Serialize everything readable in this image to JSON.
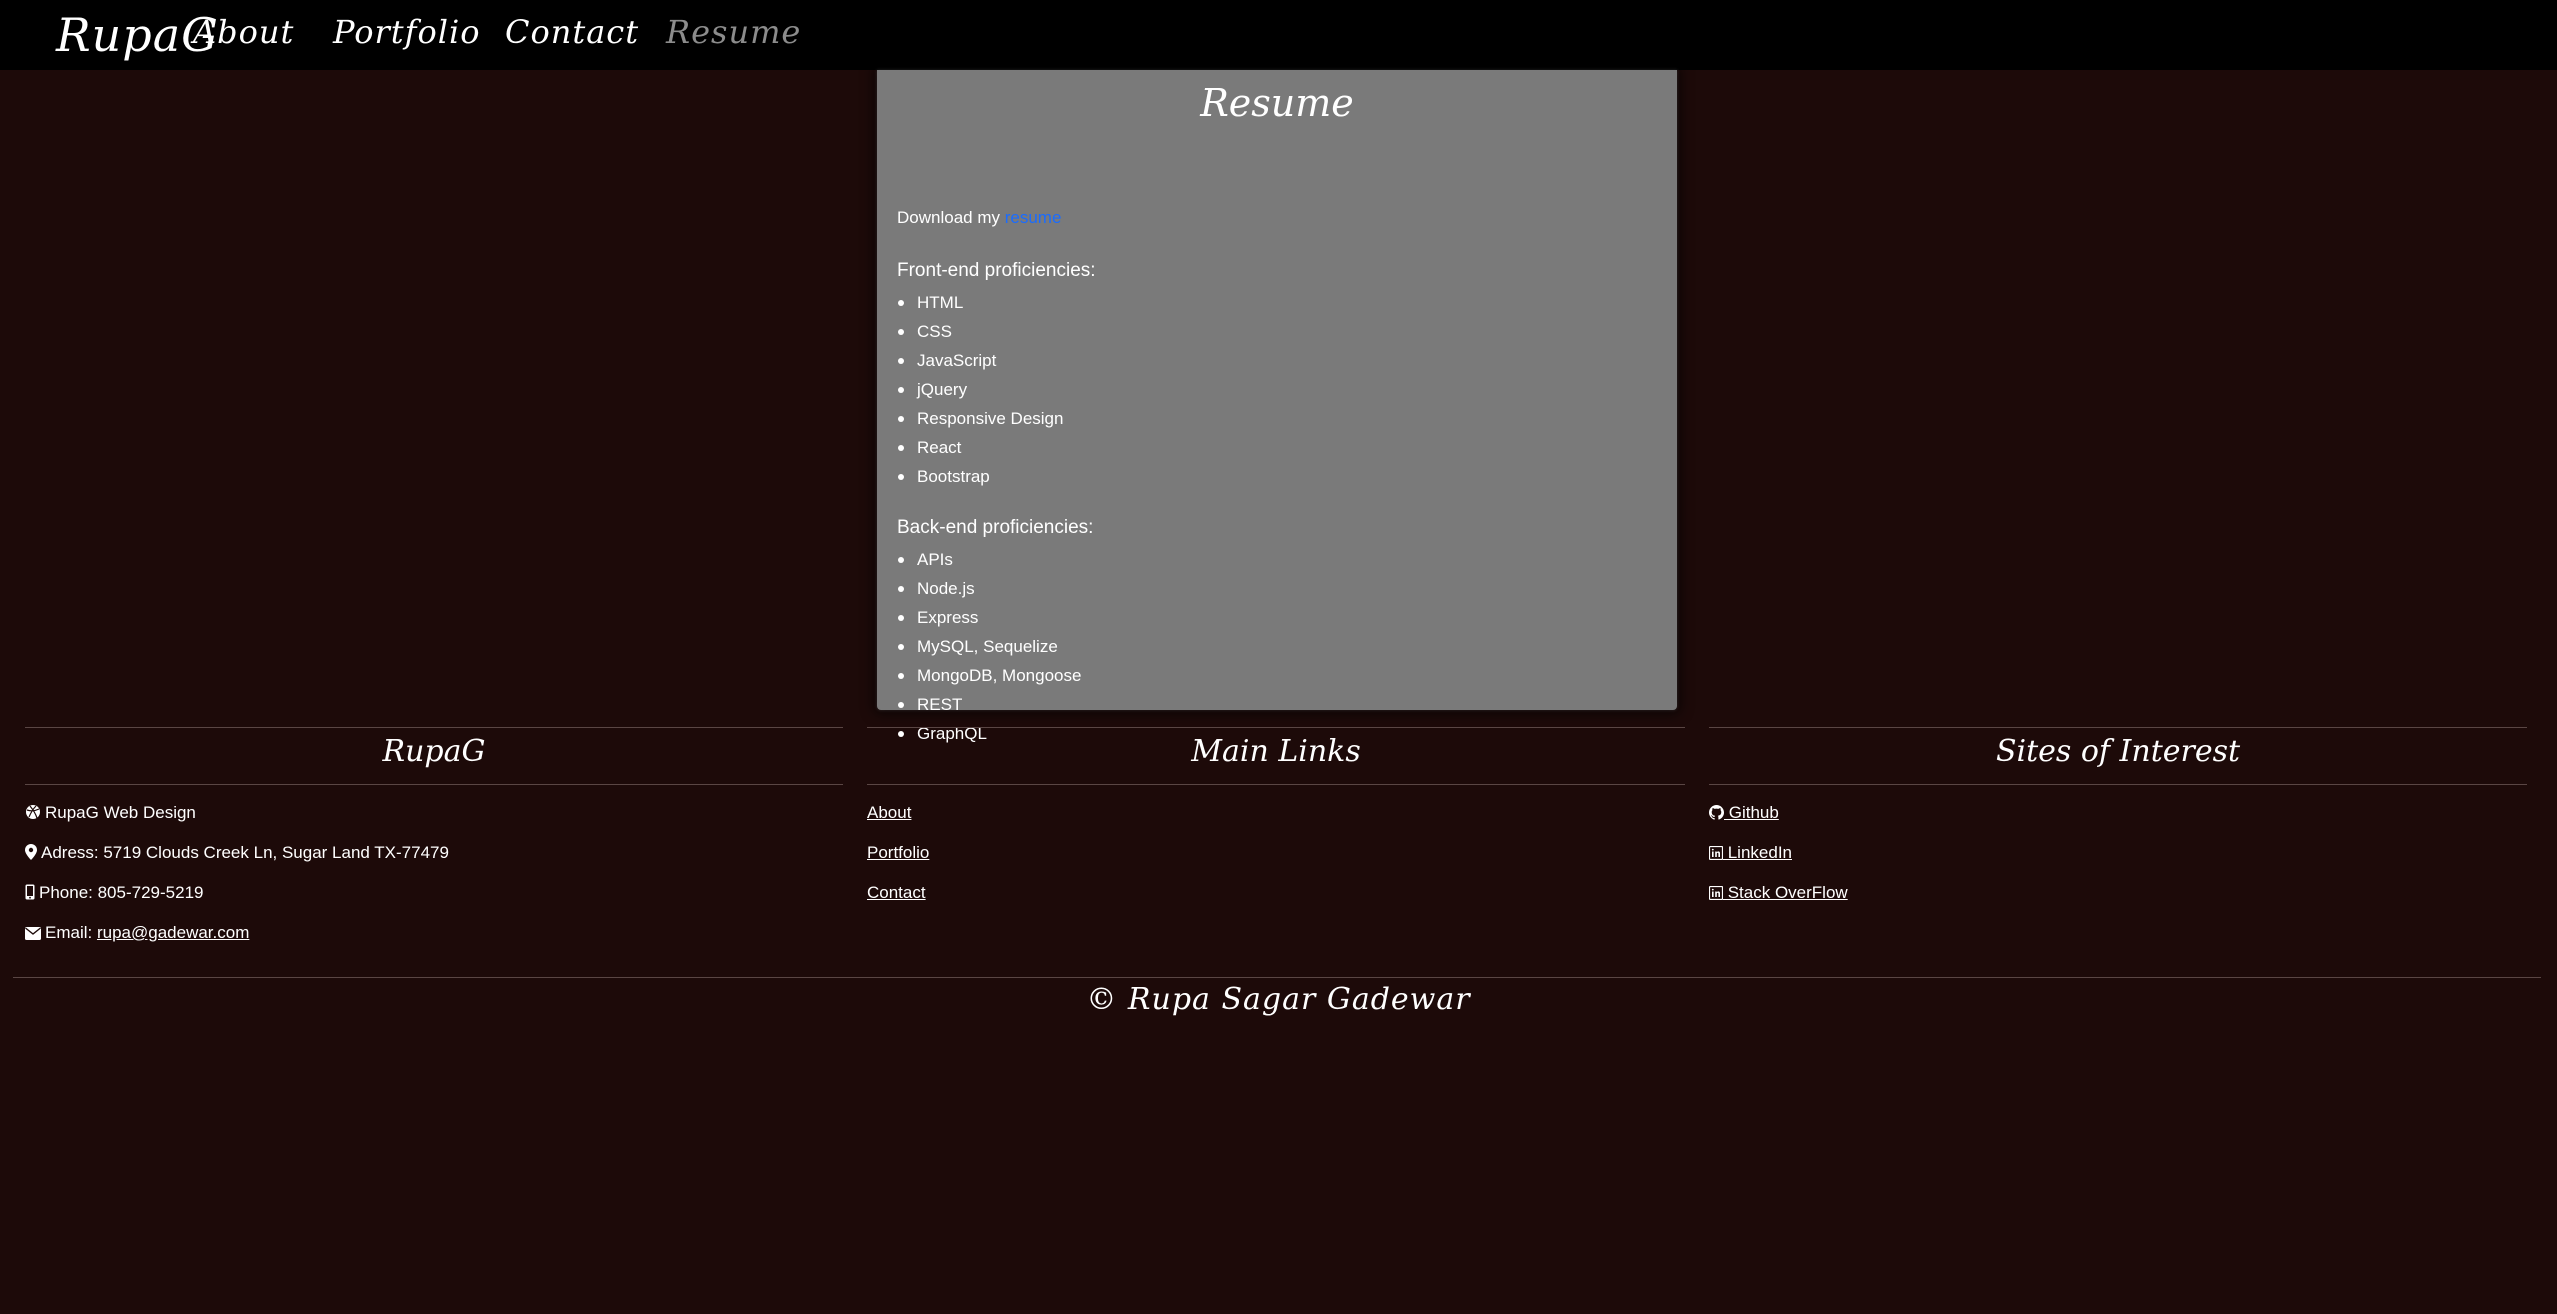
{
  "nav": {
    "brand": "RupaG",
    "links": [
      "About",
      "Portfolio",
      "Contact",
      "Resume"
    ],
    "active": "Resume"
  },
  "resume": {
    "title": "Resume",
    "download_prefix": "Download my",
    "download_link": "resume",
    "frontend_heading": "Front-end proficiencies:",
    "frontend": [
      "HTML",
      "CSS",
      "JavaScript",
      "jQuery",
      "Responsive Design",
      "React",
      "Bootstrap"
    ],
    "backend_heading": "Back-end proficiencies:",
    "backend": [
      "APIs",
      "Node.js",
      "Express",
      "MySQL, Sequelize",
      "MongoDB, Mongoose",
      "REST",
      "GraphQL"
    ]
  },
  "footer": {
    "col1": {
      "title": "RupaG",
      "company": "RupaG Web Design",
      "address": "Adress: 5719 Clouds Creek Ln, Sugar Land TX-77479",
      "phone": "Phone: 805-729-5219",
      "email_label": "Email:",
      "email": "rupa@gadewar.com"
    },
    "col2": {
      "title": "Main Links",
      "links": [
        "About",
        "Portfolio",
        "Contact"
      ]
    },
    "col3": {
      "title": "Sites of Interest",
      "links": [
        " Github",
        " LinkedIn",
        " Stack OverFlow"
      ]
    },
    "copyright": "© Rupa Sagar Gadewar"
  },
  "colors": {
    "background": "#1d0a09",
    "navbar": "#000000",
    "card": "#7a7a7a",
    "link_blue": "#1a6cff",
    "nav_active": "#8c8c8c"
  },
  "icons": [
    "dribbble-icon",
    "map-marker-icon",
    "mobile-phone-icon",
    "envelope-icon",
    "github-icon",
    "linkedin-icon",
    "linkedin-icon"
  ]
}
